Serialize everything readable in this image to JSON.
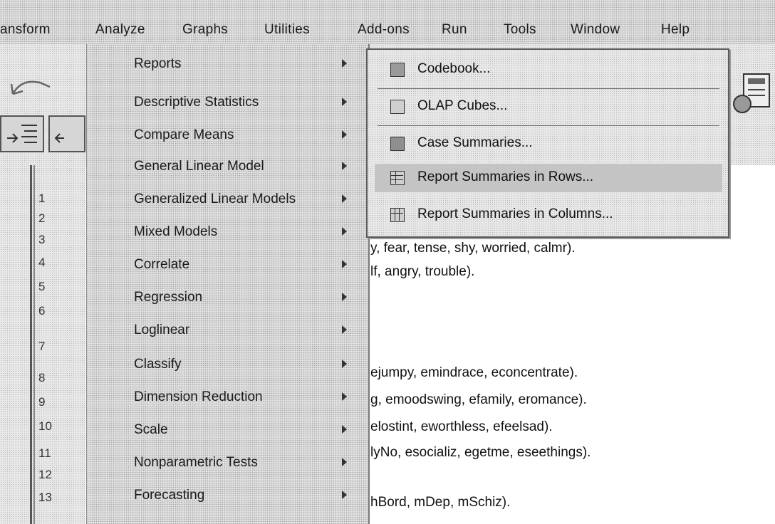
{
  "menubar": {
    "items": [
      "ansform",
      "Analyze",
      "Graphs",
      "Utilities",
      "Add-ons",
      "Run",
      "Tools",
      "Window",
      "Help"
    ]
  },
  "row_numbers": [
    "1",
    "2",
    "3",
    "4",
    "5",
    "6",
    "7",
    "8",
    "9",
    "10",
    "11",
    "12",
    "13"
  ],
  "analyze_menu": {
    "items": [
      {
        "label": "Reports"
      },
      {
        "label": "Descriptive Statistics"
      },
      {
        "label": "Compare Means"
      },
      {
        "label": "General Linear Model"
      },
      {
        "label": "Generalized Linear Models"
      },
      {
        "label": "Mixed Models"
      },
      {
        "label": "Correlate"
      },
      {
        "label": "Regression"
      },
      {
        "label": "Loglinear"
      },
      {
        "label": "Classify"
      },
      {
        "label": "Dimension Reduction"
      },
      {
        "label": "Scale"
      },
      {
        "label": "Nonparametric Tests"
      },
      {
        "label": "Forecasting"
      }
    ]
  },
  "reports_menu": {
    "items": [
      {
        "label": "Codebook...",
        "icon": "codebook-icon"
      },
      {
        "label": "OLAP Cubes...",
        "icon": "olap-cubes-icon"
      },
      {
        "label": "Case Summaries...",
        "icon": "case-summaries-icon"
      },
      {
        "label": "Report Summaries in Rows...",
        "icon": "report-rows-icon"
      },
      {
        "label": "Report Summaries in Columns...",
        "icon": "report-columns-icon"
      }
    ]
  },
  "content_lines": [
    "y, fear, tense, shy, worried, calmr).",
    "lf, angry, trouble).",
    "ejumpy, emindrace, econcentrate).",
    "g, emoodswing, efamily, eromance).",
    "elostint, eworthless, efeelsad).",
    "lyNo, esocializ, egetme, eseethings).",
    "hBord, mDep, mSchiz)."
  ]
}
